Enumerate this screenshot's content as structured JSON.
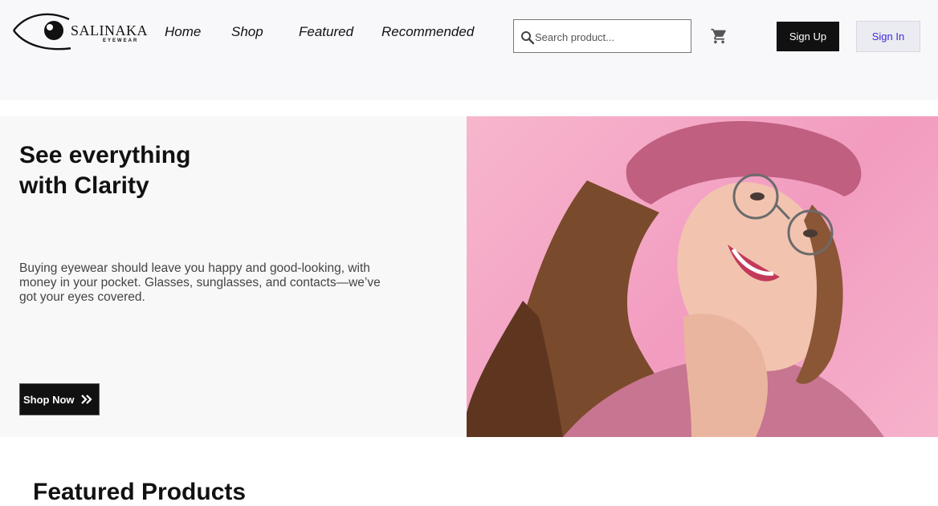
{
  "brand": {
    "name": "SALINAKA",
    "subtitle": "EYEWEAR"
  },
  "nav": {
    "items": [
      {
        "label": "Home"
      },
      {
        "label": "Shop"
      },
      {
        "label": "Featured"
      },
      {
        "label": "Recommended"
      }
    ]
  },
  "search": {
    "placeholder": "Search product...",
    "value": "",
    "icon": "search-icon"
  },
  "cart": {
    "icon": "cart-icon"
  },
  "auth": {
    "signup_label": "Sign Up",
    "signin_label": "Sign In"
  },
  "hero": {
    "title_line1": "See everything",
    "title_line2": "with Clarity",
    "text": "Buying eyewear should leave you happy and good-looking, with money in your pocket. Glasses, sunglasses, and contacts—we’ve got your eyes covered.",
    "cta_label": "Shop Now",
    "cta_icon": "double-chevron-right-icon"
  },
  "featured": {
    "title": "Featured Products"
  },
  "colors": {
    "header_bg": "#f8f8fa",
    "hero_bg": "#f8f8f8",
    "hero_image_bg": "#f4a8c6",
    "button_dark": "#111111",
    "signin_text": "#3a2bd6"
  }
}
